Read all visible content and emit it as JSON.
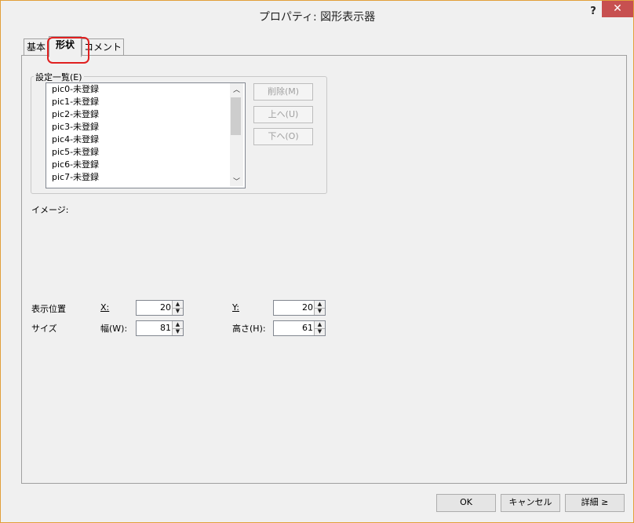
{
  "window": {
    "title": "プロパティ: 図形表示器",
    "help_label": "?",
    "close_label": "✕"
  },
  "tabs": [
    {
      "label": "基本"
    },
    {
      "label": "形状"
    },
    {
      "label": "コメント"
    }
  ],
  "settings": {
    "group_label": "設定一覧(E)",
    "items": [
      "pic0-未登録",
      "pic1-未登録",
      "pic2-未登録",
      "pic3-未登録",
      "pic4-未登録",
      "pic5-未登録",
      "pic6-未登録",
      "pic7-未登録"
    ],
    "scroll_up": "︿",
    "scroll_down": "﹀",
    "delete_label": "削除(M)",
    "up_label": "上へ(U)",
    "down_label": "下へ(O)"
  },
  "image": {
    "label": "イメージ:"
  },
  "position": {
    "label": "表示位置",
    "x_label": "X:",
    "x_value": "20",
    "y_label": "Y:",
    "y_value": "20"
  },
  "size": {
    "label": "サイズ",
    "w_label": "幅(W):",
    "w_value": "81",
    "h_label": "高さ(H):",
    "h_value": "61"
  },
  "footer": {
    "ok_label": "OK",
    "cancel_label": "キャンセル",
    "detail_label": "詳細 ≥"
  },
  "colors": {
    "close_bg": "#c75050",
    "highlight": "#e02020",
    "window_border": "#e2a03a"
  }
}
